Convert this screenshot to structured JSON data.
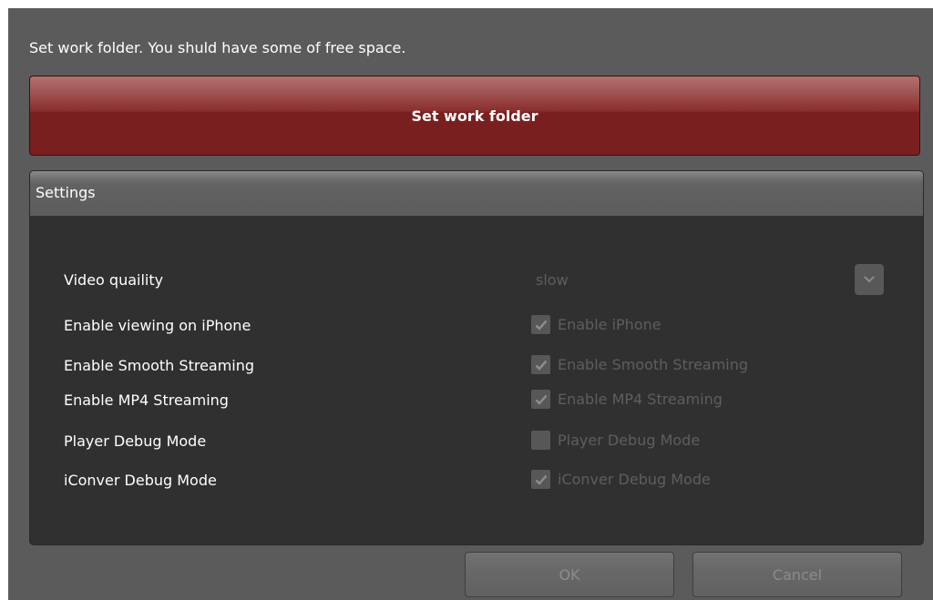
{
  "instruction": "Set work folder. You shuld have some of free space.",
  "work_folder_button": "Set work folder",
  "settings": {
    "title": "Settings",
    "video_quality": {
      "label": "Video quaility",
      "value": "slow",
      "arrow_icon": "chevron-down-icon"
    },
    "options": [
      {
        "label": "Enable viewing on iPhone",
        "checkbox_label": "Enable iPhone",
        "checked": true
      },
      {
        "label": "Enable Smooth Streaming",
        "checkbox_label": "Enable Smooth Streaming",
        "checked": true
      },
      {
        "label": "Enable MP4 Streaming",
        "checkbox_label": "Enable MP4 Streaming",
        "checked": true
      },
      {
        "label": "Player Debug Mode",
        "checkbox_label": "Player Debug Mode",
        "checked": false
      },
      {
        "label": "iConver Debug Mode",
        "checkbox_label": "iConver Debug Mode",
        "checked": true
      }
    ]
  },
  "buttons": {
    "ok": "OK",
    "cancel": "Cancel"
  },
  "colors": {
    "window_bg": "#5b5b5b",
    "primary_button": "#7a1f1f",
    "panel_bg": "#303030",
    "disabled_text": "#5e5e5e"
  }
}
